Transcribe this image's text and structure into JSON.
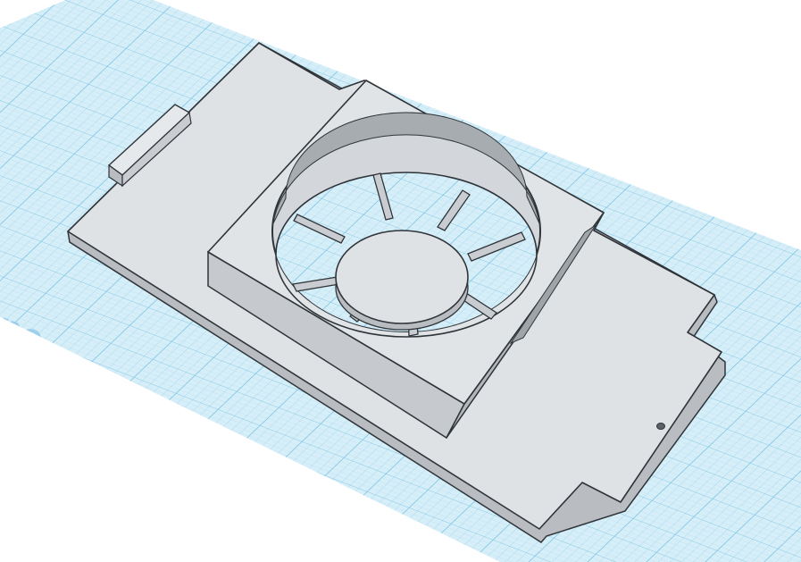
{
  "viewport": {
    "workplane_watermark": "ne",
    "background_color": "#ffffff"
  },
  "workplane": {
    "fill_color": "#d6eef8",
    "grid_minor_color": "#a9d8ee",
    "grid_major_color": "#6fbfe2",
    "watermark_color": "#9fd0ea"
  },
  "model": {
    "body_color": "#dfe2e5",
    "side_color": "#b9bdc2",
    "edge_color": "#2f3438",
    "vent_spoke_count": 8
  }
}
